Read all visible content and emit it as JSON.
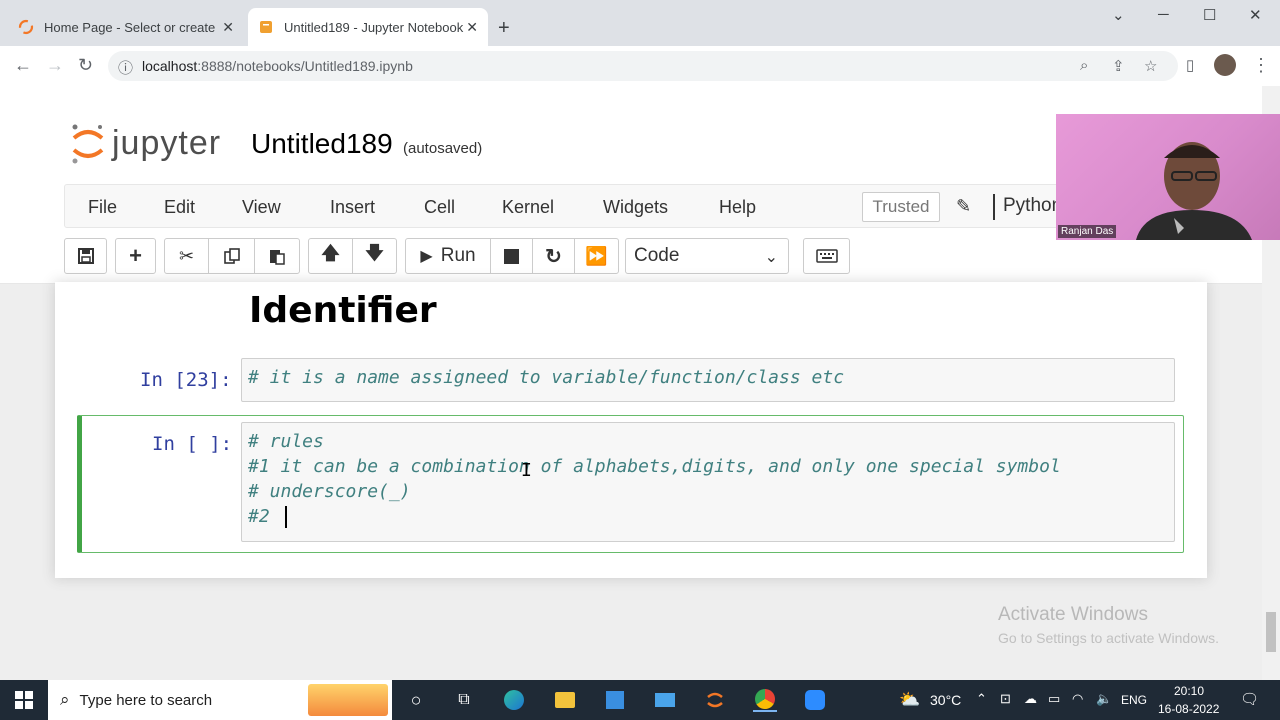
{
  "browser": {
    "tabs": [
      {
        "title": "Home Page - Select or create a n",
        "active": false
      },
      {
        "title": "Untitled189 - Jupyter Notebook",
        "active": true
      }
    ],
    "url_host": "localhost",
    "url_rest": ":8888/notebooks/Untitled189.ipynb"
  },
  "jupyter": {
    "logo_text": "jupyter",
    "notebook_title": "Untitled189",
    "save_status": "(autosaved)",
    "menu": [
      "File",
      "Edit",
      "View",
      "Insert",
      "Cell",
      "Kernel",
      "Widgets",
      "Help"
    ],
    "trusted_label": "Trusted",
    "kernel_name": "Python",
    "run_label": "Run",
    "cell_type": "Code"
  },
  "cells": {
    "heading": "Identifier",
    "cell1": {
      "prompt": "In [23]:",
      "lines": [
        "# it is a name assigneed to variable/function/class etc"
      ]
    },
    "cell2": {
      "prompt": "In [ ]:",
      "lines": [
        "# rules",
        "#1 it can be a combination of alphabets,digits, and only one special symbol",
        "# underscore(_)",
        "#2 "
      ]
    }
  },
  "watermark": {
    "title": "Activate Windows",
    "subtitle": "Go to Settings to activate Windows."
  },
  "webcam": {
    "label": "Ranjan Das"
  },
  "taskbar": {
    "search_placeholder": "Type here to search",
    "temperature": "30°C",
    "language": "ENG",
    "time": "20:10",
    "date": "16-08-2022"
  },
  "colors": {
    "jupyter_orange": "#f37726",
    "selected_cell_border": "#42a546",
    "comment_color": "#408080",
    "prompt_color": "#303f9f",
    "taskbar_bg": "#1f2a36"
  }
}
